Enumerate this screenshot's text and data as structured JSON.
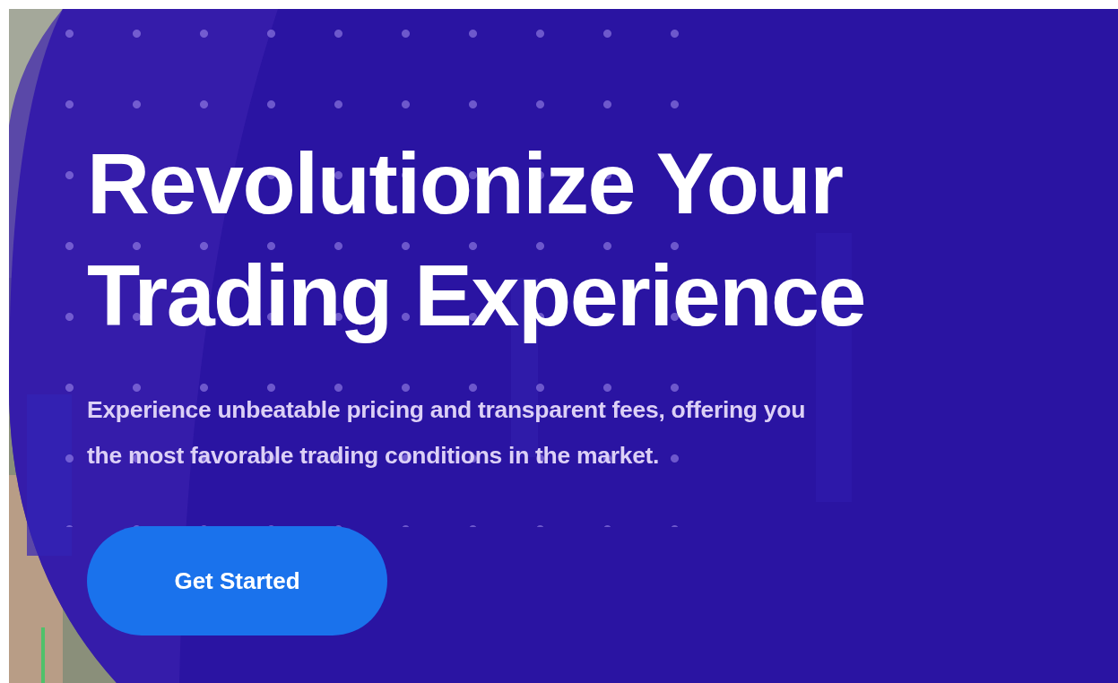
{
  "hero": {
    "headline_lines": [
      "Revolutionize Your",
      "Trading Experience"
    ],
    "subtitle_lines": [
      "Experience unbeatable pricing and transparent fees, offering you",
      "the most favorable trading conditions in the market."
    ],
    "button": {
      "label": "Get Started"
    }
  }
}
